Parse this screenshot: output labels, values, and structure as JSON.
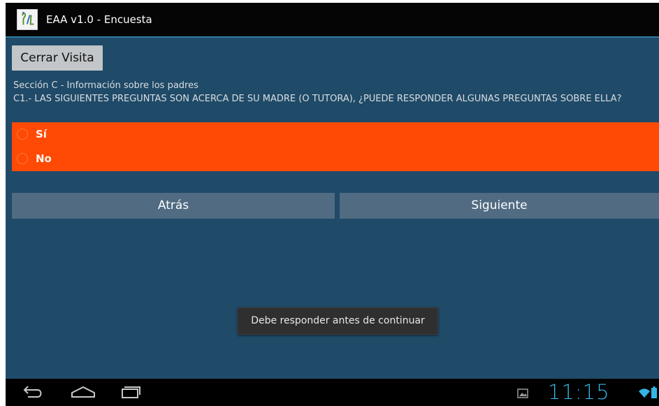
{
  "app": {
    "title": "EAA v1.0 - Encuesta",
    "icon": "app-logo-icon"
  },
  "toolbar": {
    "close_visit_label": "Cerrar Visita"
  },
  "survey": {
    "section_title": "Sección C - Información sobre los padres",
    "question": "C1.- LAS SIGUIENTES PREGUNTAS SON ACERCA DE SU MADRE (O TUTORA), ¿PUEDE RESPONDER ALGUNAS PREGUNTAS SOBRE ELLA?",
    "options": [
      {
        "label": "Sí",
        "selected": false
      },
      {
        "label": "No",
        "selected": false
      }
    ],
    "options_background": "#fe4a05"
  },
  "navigation": {
    "back_label": "Atrás",
    "next_label": "Siguiente"
  },
  "toast": {
    "message": "Debe responder antes de continuar"
  },
  "system_bar": {
    "clock": "11:15",
    "clock_color": "#33b5e5",
    "icons": [
      "back-icon",
      "home-icon",
      "recent-apps-icon",
      "gallery-notification-icon",
      "wifi-icon",
      "battery-icon"
    ]
  },
  "colors": {
    "content_background": "#1f4a68",
    "title_divider": "#2d7fa6",
    "nav_button": "#506b82"
  }
}
